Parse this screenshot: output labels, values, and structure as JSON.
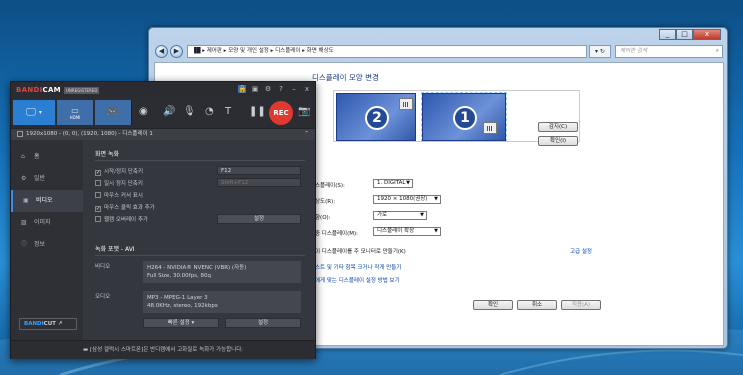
{
  "control_panel": {
    "window_buttons": [
      "_",
      "□",
      "x"
    ],
    "address": "▐█ ▸ 제어판 ▸ 모양 및 개인 설정 ▸ 디스플레이 ▸ 화면 해상도",
    "address_go": "▾ ↻",
    "search_placeholder": "제어판 검색",
    "heading": "디스플레이 모양 변경",
    "monitor_1": "1",
    "monitor_2": "2",
    "detect_button": "감지(C)",
    "identify_button": "확인(I)",
    "display_label": "스플레이(S):",
    "display_value": "1. DIGITAL",
    "resolution_label": "상도(R):",
    "resolution_value": "1920 × 1080(권장)",
    "orientation_label": "향(O):",
    "orientation_value": "가로",
    "multi_label": "중 디스플레이(M):",
    "multi_value": "디스플레이 확장",
    "main_display_text": "이 디스플레이를 주 모니터로 만들기(K)",
    "advanced_link": "고급 설정",
    "link_1": "스트 및 기타 항목 크거나 작게 만들기",
    "link_2": "에게 맞는 디스플레이 설정 방법 보기",
    "ok_button": "확인",
    "cancel_button": "취소",
    "apply_button": "적용(A)"
  },
  "bandicam": {
    "logo_a": "BANDI",
    "logo_b": "CAM",
    "unregistered": "UNREGISTERED",
    "title_icons": [
      "🔒",
      "▣",
      "⚙",
      "?",
      "–",
      "x"
    ],
    "hdmi_label": "HDMI",
    "rec": "REC",
    "status_text": "1920x1080 - (0, 0), (1920, 1080) - 디스플레이 1",
    "status_up": "⌃",
    "sidebar": [
      "홈",
      "일반",
      "비디오",
      "이미지",
      "정보"
    ],
    "bandicut_a": "BANDI",
    "bandicut_b": "CUT ↗",
    "section_record": "화면 녹화",
    "opt_start_stop": "시작/정지 단축키",
    "opt_start_stop_key": "F12",
    "opt_pause": "일시 정지 단축키",
    "opt_pause_key": "Shift+F12",
    "opt_cursor": "마우스 커서 표시",
    "opt_click": "마우스 클릭 효과 추가",
    "opt_webcam": "웹캠 오버레이 추가",
    "settings_button": "설정",
    "section_format": "녹화 포맷 - AVI",
    "video_label": "비디오",
    "video_line1": "H264 - NVIDIA® NVENC (VBR) (자동)",
    "video_line2": "Full Size, 30.00fps, 80q",
    "audio_label": "오디오",
    "audio_line1": "MP3 - MPEG-1 Layer 3",
    "audio_line2": "48.0KHz, stereo, 192kbps",
    "quick_settings": "빠른 설정",
    "settings_button2": "설정",
    "footer": "[삼성 갤럭시 스마트폰]은 반디캠에서 고화질로 녹화가 가능합니다."
  },
  "colors": {
    "accent": "#2b7fd3",
    "rec": "#e0392f",
    "desktop": "#1670b8"
  }
}
